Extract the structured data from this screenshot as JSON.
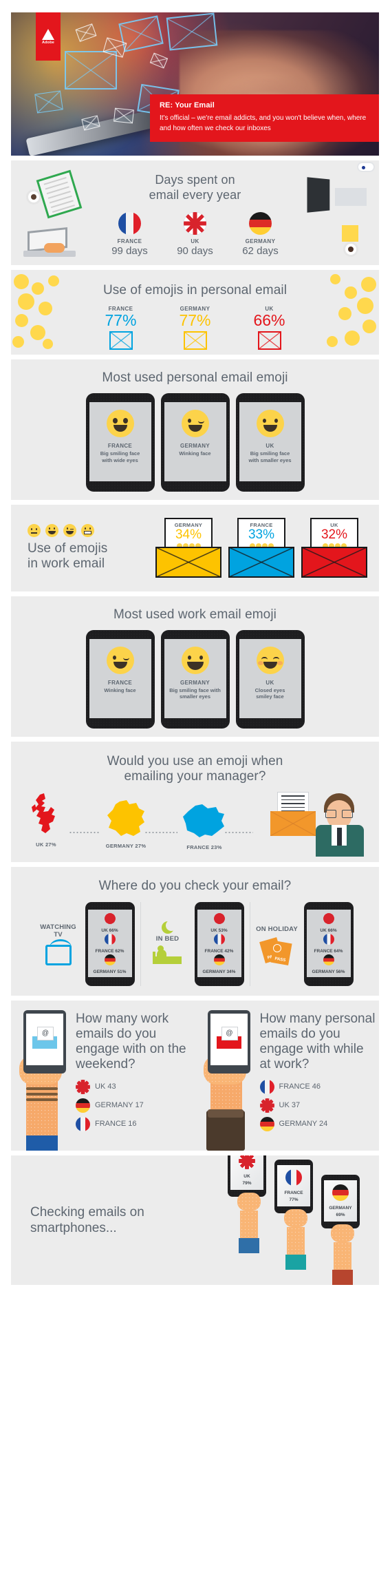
{
  "hero": {
    "brand": "Adobe",
    "title": "RE: Your Email",
    "subtitle": "It's official – we're email addicts, and you won't believe when, where and how often we check our inboxes"
  },
  "days_section": {
    "title": "Days spent on\nemail every year",
    "items": [
      {
        "country": "FRANCE",
        "value": "99 days",
        "flag": "fr"
      },
      {
        "country": "UK",
        "value": "90 days",
        "flag": "uk"
      },
      {
        "country": "GERMANY",
        "value": "62 days",
        "flag": "de"
      }
    ]
  },
  "personal_emoji_pct": {
    "title": "Use of emojis in personal email",
    "items": [
      {
        "country": "FRANCE",
        "value": "77%",
        "color": "#00a3e0"
      },
      {
        "country": "GERMANY",
        "value": "77%",
        "color": "#fdc300"
      },
      {
        "country": "UK",
        "value": "66%",
        "color": "#e3161c"
      }
    ]
  },
  "most_used_personal": {
    "title": "Most used personal email emoji",
    "items": [
      {
        "country": "FRANCE",
        "desc": "Big smiling face\nwith wide eyes",
        "face": "big-smile-wide-eyes"
      },
      {
        "country": "GERMANY",
        "desc": "Winking face",
        "face": "winking"
      },
      {
        "country": "UK",
        "desc": "Big smiling face\nwith smaller eyes",
        "face": "big-smile-small-eyes"
      }
    ]
  },
  "work_emoji_pct": {
    "title": "Use of emojis\nin work email",
    "items": [
      {
        "country": "GERMANY",
        "value": "34%",
        "color": "#fdc300"
      },
      {
        "country": "FRANCE",
        "value": "33%",
        "color": "#00a3e0"
      },
      {
        "country": "UK",
        "value": "32%",
        "color": "#e3161c"
      }
    ]
  },
  "most_used_work": {
    "title": "Most used work email emoji",
    "items": [
      {
        "country": "FRANCE",
        "desc": "Winking face",
        "face": "winking"
      },
      {
        "country": "GERMANY",
        "desc": "Big smiling face with\nsmaller eyes",
        "face": "big-smile-small-eyes"
      },
      {
        "country": "UK",
        "desc": "Closed eyes\nsmiley face",
        "face": "closed-eyes-smiley"
      }
    ]
  },
  "manager_section": {
    "title": "Would you use an emoji when\nemailing your manager?",
    "items": [
      {
        "label": "UK 27%",
        "country": "UK",
        "color": "#e3161c"
      },
      {
        "label": "GERMANY 27%",
        "country": "GERMANY",
        "color": "#fdc300"
      },
      {
        "label": "FRANCE 23%",
        "country": "FRANCE",
        "color": "#00a3e0"
      }
    ]
  },
  "where_section": {
    "title": "Where do you check your email?",
    "places": [
      {
        "label": "WATCHING\nTV",
        "icon": "tv-icon",
        "stats": [
          {
            "country": "UK",
            "text": "UK 66%",
            "flag": "uk"
          },
          {
            "country": "FRANCE",
            "text": "FRANCE 62%",
            "flag": "fr"
          },
          {
            "country": "GERMANY",
            "text": "GERMANY 51%",
            "flag": "de"
          }
        ]
      },
      {
        "label": "IN BED",
        "icon": "bed-icon",
        "stats": [
          {
            "country": "UK",
            "text": "UK 53%",
            "flag": "uk"
          },
          {
            "country": "FRANCE",
            "text": "FRANCE 42%",
            "flag": "fr"
          },
          {
            "country": "GERMANY",
            "text": "GERMANY 34%",
            "flag": "de"
          }
        ]
      },
      {
        "label": "ON HOLIDAY",
        "icon": "passport-icon",
        "stats": [
          {
            "country": "UK",
            "text": "UK 66%",
            "flag": "uk"
          },
          {
            "country": "FRANCE",
            "text": "FRANCE 64%",
            "flag": "fr"
          },
          {
            "country": "GERMANY",
            "text": "GERMANY 56%",
            "flag": "de"
          }
        ]
      }
    ]
  },
  "engage_section": {
    "left": {
      "question": "How many work emails do you engage with on the weekend?",
      "items": [
        {
          "text": "UK 43",
          "flag": "uk"
        },
        {
          "text": "GERMANY 17",
          "flag": "de"
        },
        {
          "text": "FRANCE 16",
          "flag": "fr"
        }
      ]
    },
    "right": {
      "question": "How many personal emails do you engage with while at work?",
      "items": [
        {
          "text": "FRANCE 46",
          "flag": "fr"
        },
        {
          "text": "UK 37",
          "flag": "uk"
        },
        {
          "text": "GERMANY 24",
          "flag": "de"
        }
      ]
    }
  },
  "smartphone_section": {
    "title": "Checking emails on\nsmartphones...",
    "items": [
      {
        "country": "UK",
        "value": "79%",
        "flag": "uk"
      },
      {
        "country": "FRANCE",
        "value": "77%",
        "flag": "fr"
      },
      {
        "country": "GERMANY",
        "value": "69%",
        "flag": "de"
      }
    ]
  },
  "colors": {
    "adobe_red": "#e3161c",
    "blue": "#00a3e0",
    "yellow": "#fdc300",
    "grey_text": "#5d6670",
    "panel_bg": "#ececec"
  }
}
